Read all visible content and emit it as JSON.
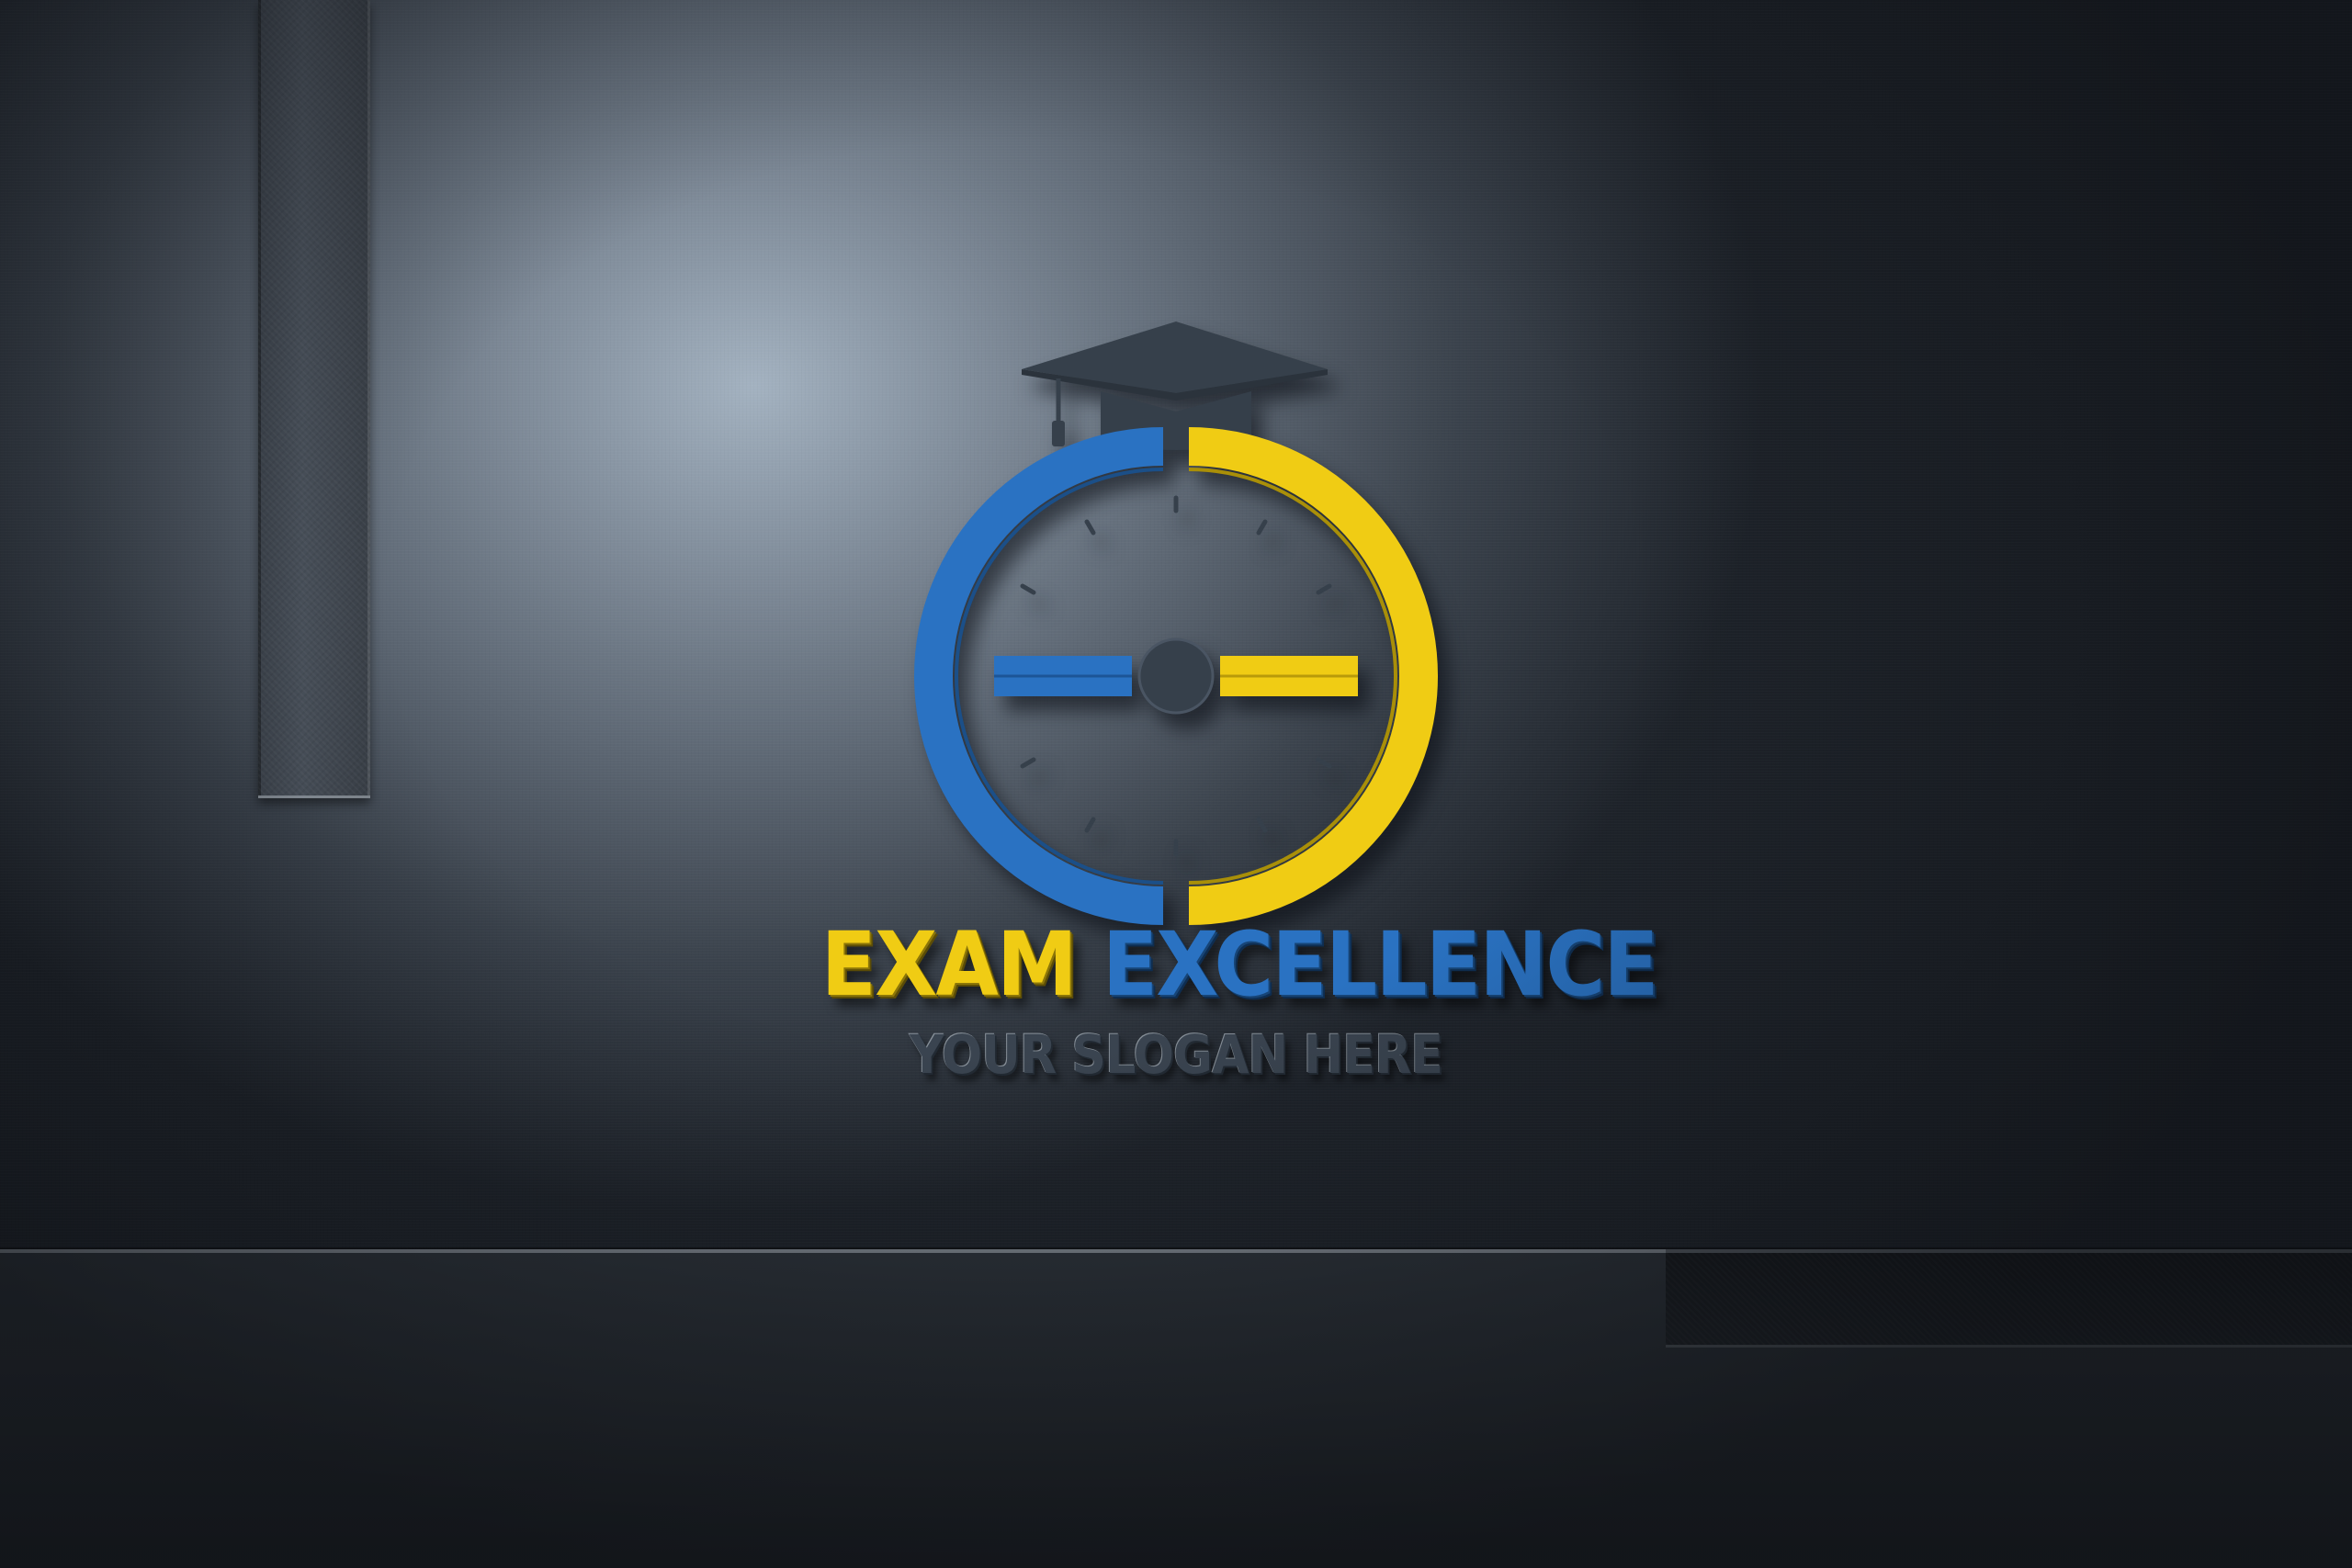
{
  "logo": {
    "brand_word_1": "EXAM",
    "brand_word_2": "EXCELLENCE",
    "slogan": "YOUR SLOGAN HERE",
    "icons": [
      "graduation-cap-icon",
      "stopwatch-icon"
    ]
  },
  "colors": {
    "yellow": "#f0cc14",
    "blue": "#2a72c2",
    "dark_slate": "#3a4450",
    "wall": "#8a96a3"
  }
}
